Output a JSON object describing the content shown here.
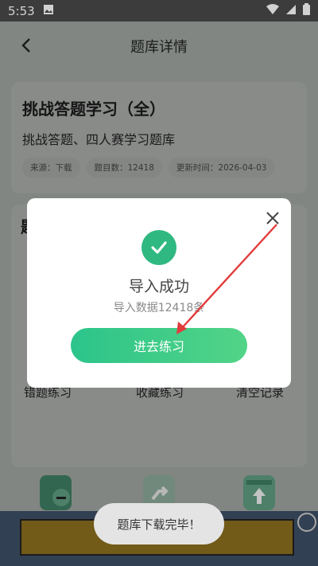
{
  "status_bar": {
    "time": "5:53"
  },
  "nav": {
    "title": "题库详情"
  },
  "card": {
    "title": "挑战答题学习（全）",
    "subtitle": "挑战答题、四人赛学习题库",
    "meta": [
      "来源：下载",
      "题目数：12418",
      "更新时间：2026-04-03"
    ]
  },
  "section": {
    "title_partial": "题"
  },
  "grid": {
    "wrong_practice": "错题练习",
    "favorite_practice": "收藏练习",
    "clear_records": "清空记录"
  },
  "dialog": {
    "title": "导入成功",
    "description": "导入数据12418条",
    "primary_button": "进去练习"
  },
  "toast": {
    "message": "题库下载完毕！"
  },
  "colors": {
    "accent": "#2fb880",
    "annotation": "#e23b3b"
  }
}
